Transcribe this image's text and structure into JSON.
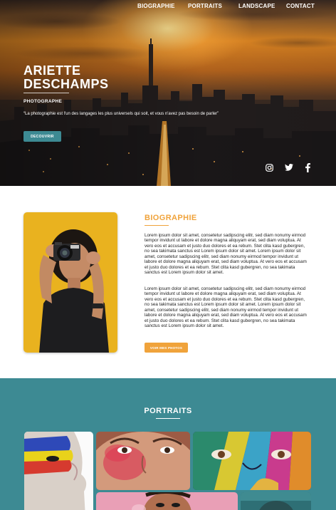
{
  "nav": {
    "items": [
      "BIOGRAPHIE",
      "PORTRAITS",
      "LANDSCAPE",
      "CONTACT"
    ]
  },
  "hero": {
    "name_line1": "ARIETTE",
    "name_line2": "DESCHAMPS",
    "subtitle": "PHOTOGRAPHE",
    "quote": "“La photographie est l'un des langages les plus universels qui soit, et vous n'avez pas besoin de parler”",
    "button_label": "DECOUVRIR",
    "social": [
      "instagram-icon",
      "twitter-icon",
      "facebook-icon"
    ]
  },
  "biography": {
    "title": "BIOGRAPHIE",
    "paragraph1": "Lorem ipsum dolor sit amet, consetetur sadipscing elitr, sed diam nonumy eirmod tempor invidunt ut labore et dolore magna aliquyam erat, sed diam voluptua. At vero eos et accusam et justo duo dolores et ea rebum. Stet clita kasd gubergren, no sea takimata sanctus est Lorem ipsum dolor sit amet. Lorem ipsum dolor sit amet, consetetur sadipscing elitr, sed diam nonumy eirmod tempor invidunt ut labore et dolore magna aliquyam erat, sed diam voluptua. At vero eos et accusam et justo duo dolores et ea rebum. Stet clita kasd gubergren, no sea takimata sanctus est Lorem ipsum dolor sit amet.",
    "paragraph2": "Lorem ipsum dolor sit amet, consetetur sadipscing elitr, sed diam nonumy eirmod tempor invidunt ut labore et dolore magna aliquyam erat, sed diam voluptua. At vero eos et accusam et justo duo dolores et ea rebum. Stet clita kasd gubergren, no sea takimata sanctus est Lorem ipsum dolor sit amet. Lorem ipsum dolor sit amet, consetetur sadipscing elitr, sed diam nonumy eirmod tempor invidunt ut labore et dolore magna aliquyam erat, sed diam voluptua. At vero eos et accusam et justo duo dolores et ea rebum. Stet clita kasd gubergren, no sea takimata sanctus est Lorem ipsum dolor sit amet.",
    "button_label": "VOIR MES PHOTOS"
  },
  "portraits": {
    "title": "PORTRAITS"
  },
  "colors": {
    "teal": "#3d8a93",
    "orange": "#f0a33b"
  }
}
